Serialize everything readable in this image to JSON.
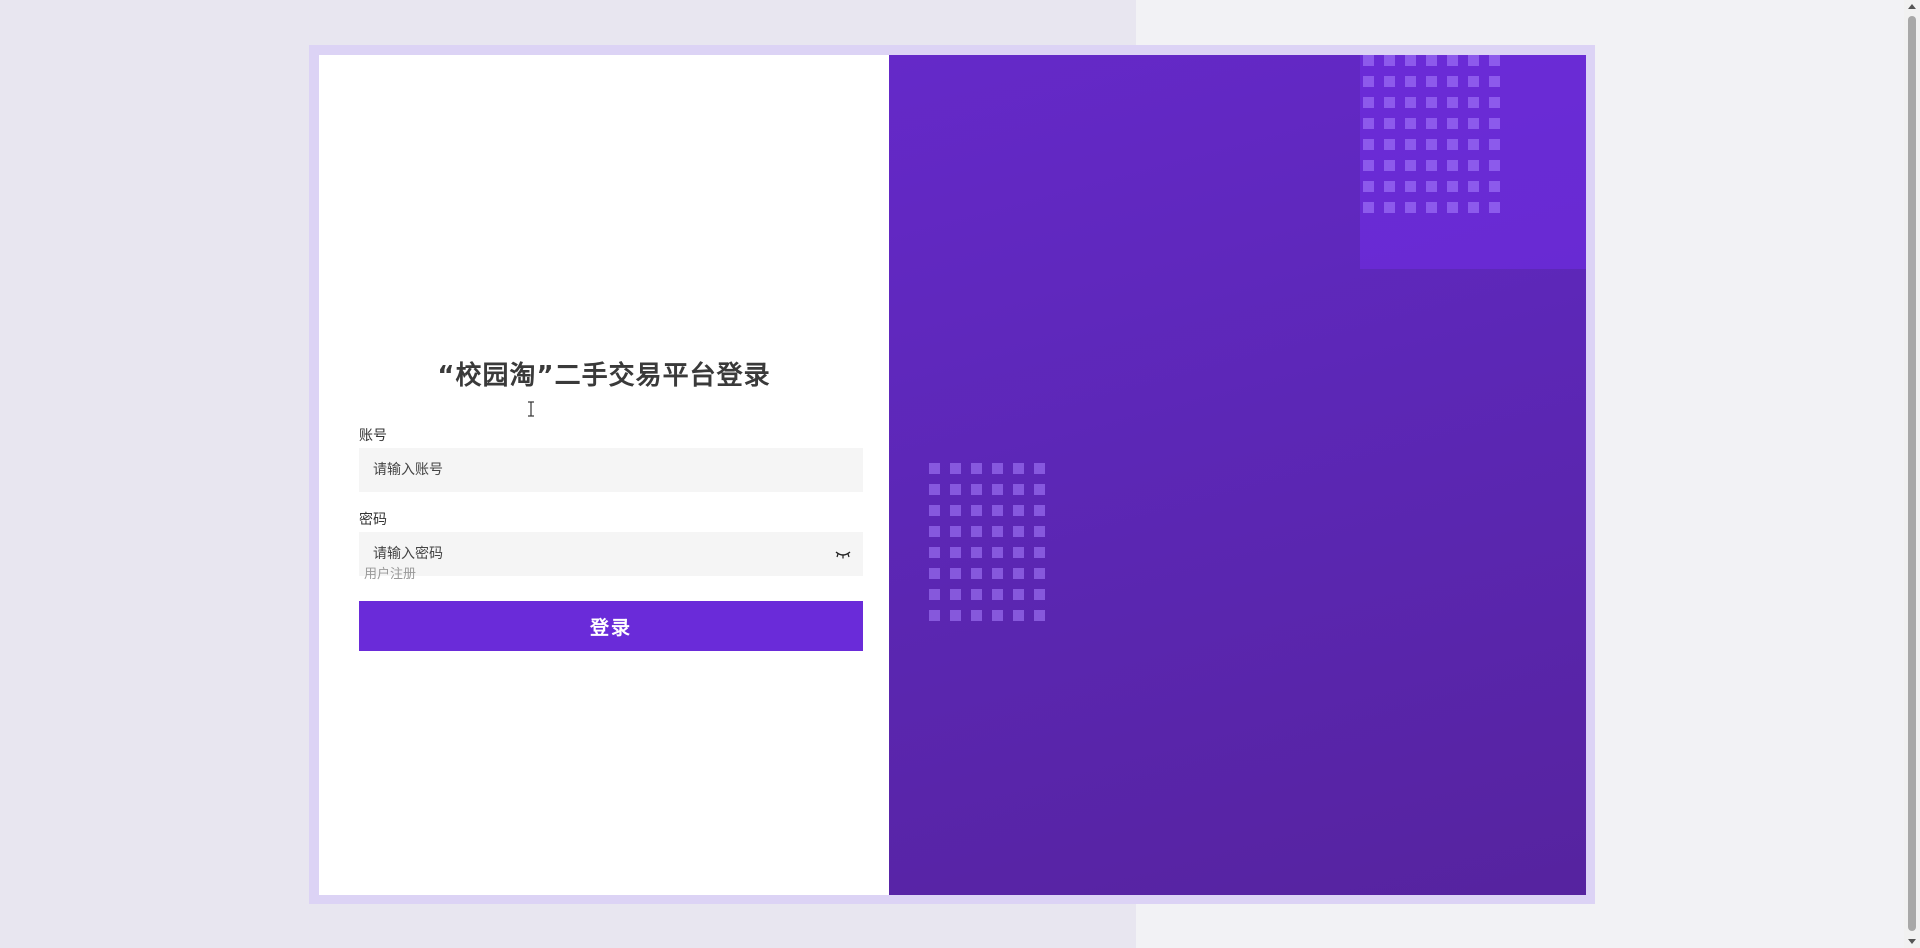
{
  "page": {
    "title": "“校园淘”二手交易平台登录"
  },
  "form": {
    "account_label": "账号",
    "account_placeholder": "请输入账号",
    "password_label": "密码",
    "password_placeholder": "请输入密码",
    "register_link": "用户注册",
    "login_button": "登录"
  },
  "icons": {
    "password_toggle": "eye-closed-icon",
    "text_cursor": "text-cursor-icon"
  },
  "colors": {
    "accent": "#6a2bd9",
    "panel_gradient_start": "#6529c9",
    "panel_gradient_end": "#56239f"
  }
}
